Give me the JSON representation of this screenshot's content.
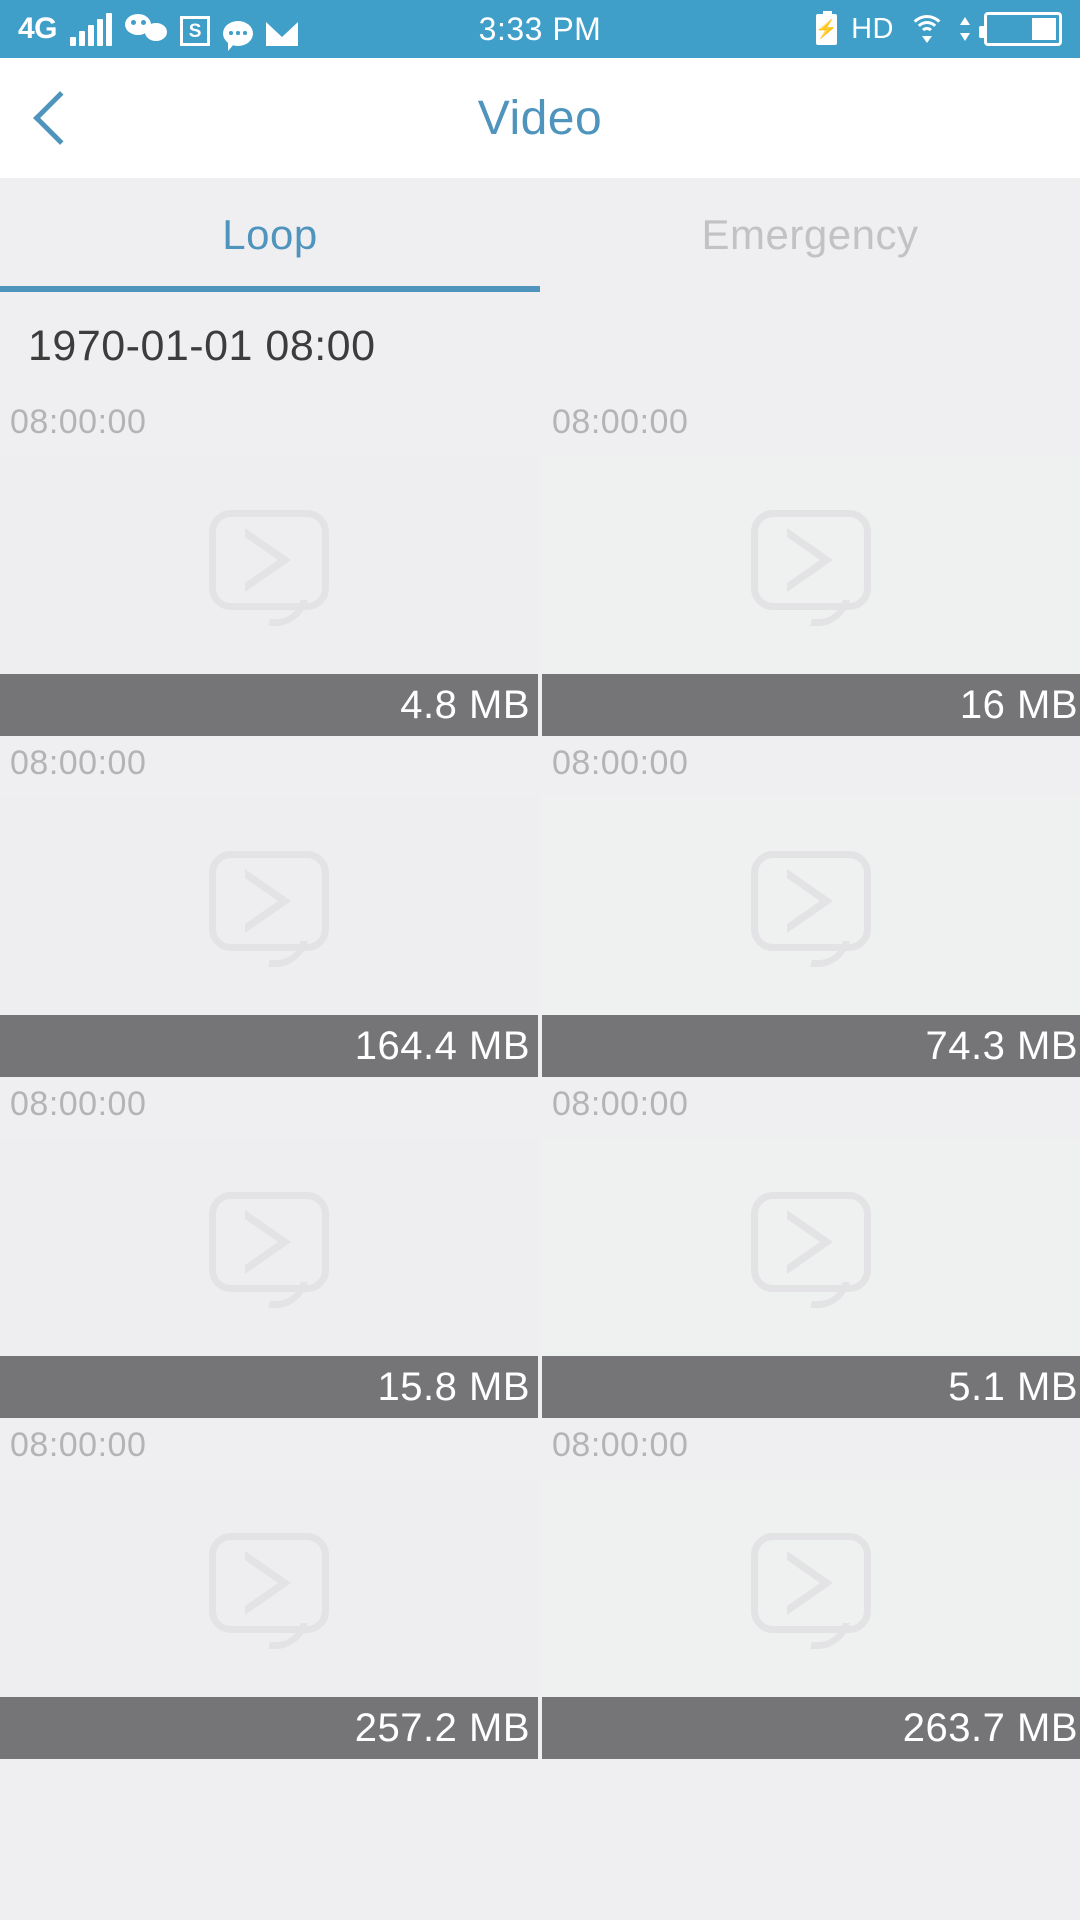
{
  "status_bar": {
    "network_type": "4G",
    "signal_icon": "signal-bars-icon",
    "app_icons": [
      "wechat-icon",
      "screenshot-s-icon",
      "chat-bubble-icon",
      "mail-icon"
    ],
    "time": "3:33 PM",
    "battery_charging_icon": "battery-charging-icon",
    "hd_label": "HD",
    "wifi_icon": "wifi-icon",
    "battery_icon": "battery-icon",
    "background_color": "#3f9fc9"
  },
  "header": {
    "back_icon": "back-chevron-icon",
    "title": "Video",
    "title_color": "#4e94bd",
    "background_color": "#ffffff"
  },
  "tabs": {
    "items": [
      {
        "label": "Loop",
        "active": true
      },
      {
        "label": "Emergency",
        "active": false
      }
    ],
    "active_color": "#4e94bd",
    "inactive_color": "#c2c2c4",
    "indicator_color": "#4e94bd"
  },
  "content": {
    "group_date": "1970-01-01 08:00",
    "placeholder_icon": "video-play-placeholder-icon",
    "size_bar_color": "#757578",
    "videos": [
      {
        "time": "08:00:00",
        "size": "4.8 MB"
      },
      {
        "time": "08:00:00",
        "size": "16 MB"
      },
      {
        "time": "08:00:00",
        "size": "164.4 MB"
      },
      {
        "time": "08:00:00",
        "size": "74.3 MB"
      },
      {
        "time": "08:00:00",
        "size": "15.8 MB"
      },
      {
        "time": "08:00:00",
        "size": "5.1 MB"
      },
      {
        "time": "08:00:00",
        "size": "257.2 MB"
      },
      {
        "time": "08:00:00",
        "size": "263.7 MB"
      }
    ]
  }
}
